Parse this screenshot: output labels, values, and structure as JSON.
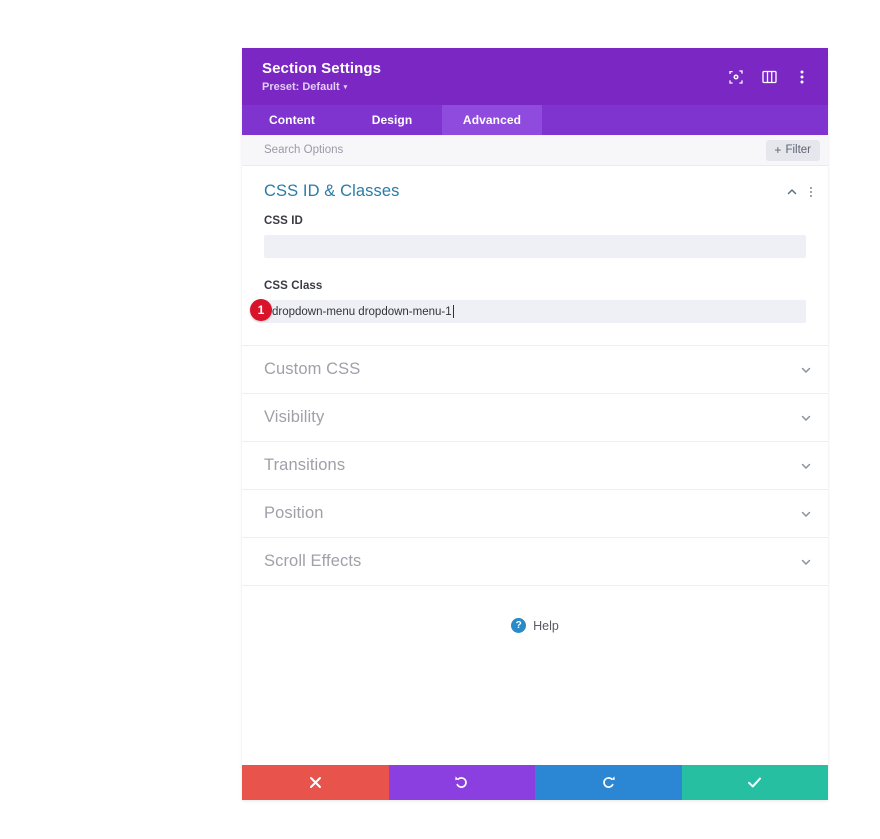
{
  "header": {
    "title": "Section Settings",
    "preset": "Preset: Default",
    "preset_caret": "▾",
    "icons": [
      "focus-target-icon",
      "panel-layout-icon",
      "more-options-icon"
    ]
  },
  "tabs": [
    {
      "label": "Content",
      "active": false
    },
    {
      "label": "Design",
      "active": false
    },
    {
      "label": "Advanced",
      "active": true
    }
  ],
  "search": {
    "placeholder": "Search Options",
    "value": "",
    "filter_label": "Filter",
    "filter_plus": "+"
  },
  "open_group": {
    "title": "CSS ID & Classes",
    "fields": [
      {
        "label": "CSS ID",
        "value": "",
        "name": "css-id"
      },
      {
        "label": "CSS Class",
        "value": "dropdown-menu dropdown-menu-1",
        "name": "css-class"
      }
    ],
    "marker_badge": "1"
  },
  "collapsed_groups": [
    {
      "label": "Custom CSS"
    },
    {
      "label": "Visibility"
    },
    {
      "label": "Transitions"
    },
    {
      "label": "Position"
    },
    {
      "label": "Scroll Effects"
    }
  ],
  "help": {
    "label": "Help",
    "icon_glyph": "?"
  },
  "footer_buttons": [
    {
      "name": "cancel-button",
      "glyph": "close-x-icon",
      "color": "#e8534c"
    },
    {
      "name": "undo-button",
      "glyph": "undo-arrow-icon",
      "color": "#8b3fe0"
    },
    {
      "name": "redo-button",
      "glyph": "redo-arrow-icon",
      "color": "#2b86d4"
    },
    {
      "name": "save-button",
      "glyph": "checkmark-icon",
      "color": "#26bfa1"
    }
  ],
  "colors": {
    "header_purple": "#7b27c4",
    "tabbar_purple": "#8034cf",
    "active_tab_purple": "#8f4ade",
    "group_title_teal": "#2a7ca8",
    "marker_red": "#d8132a",
    "help_blue": "#2a8ac8"
  }
}
